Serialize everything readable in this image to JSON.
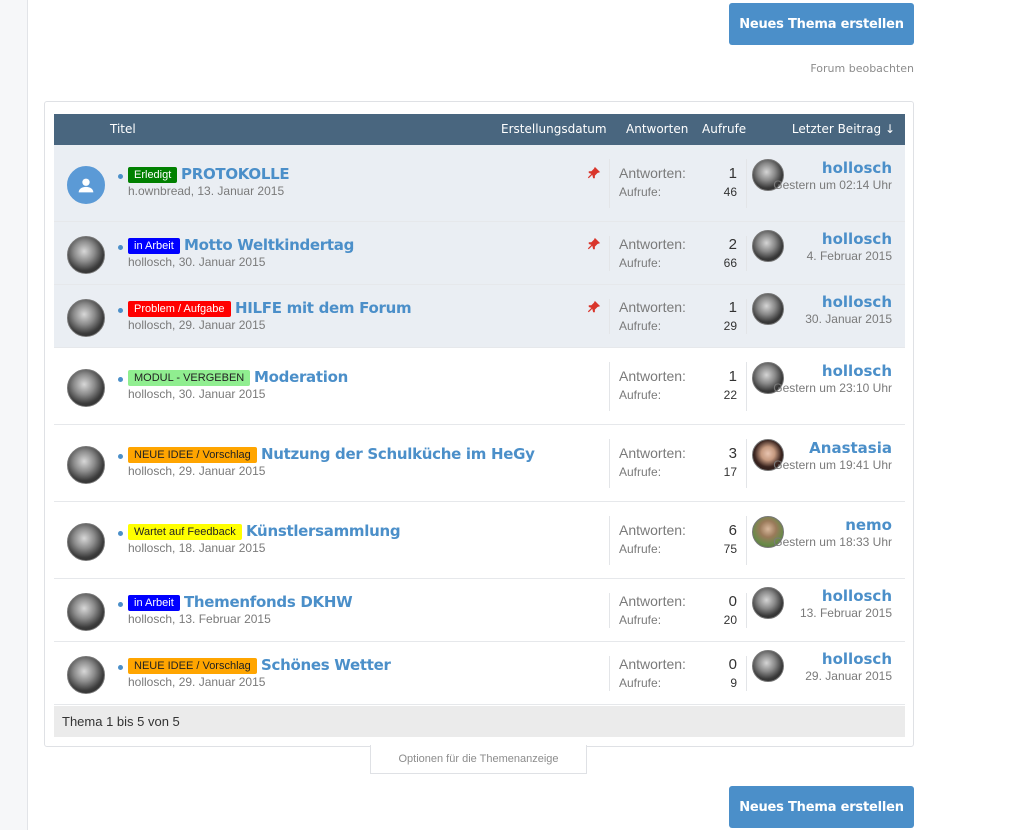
{
  "actions": {
    "new_thread": "Neues Thema erstellen",
    "watch_forum": "Forum beobachten",
    "thread_display_options": "Optionen für die Themenanzeige"
  },
  "table_header": {
    "title": "Titel",
    "created": "Erstellungsdatum",
    "replies": "Antworten",
    "views": "Aufrufe",
    "last_post": "Letzter Beitrag ↓"
  },
  "labels": {
    "replies": "Antworten:",
    "views": "Aufrufe:"
  },
  "threads": [
    {
      "prefix": "Erledigt",
      "prefix_bg": "#008000",
      "prefix_fg": "#ffffff",
      "title": "PROTOKOLLE",
      "meta": "h.ownbread, 13. Januar 2015",
      "sticky": true,
      "replies": "1",
      "views": "46",
      "last_user": "hollosch",
      "last_date": "Gestern um 02:14 Uhr",
      "avatar": "default"
    },
    {
      "prefix": "in Arbeit",
      "prefix_bg": "#0000ff",
      "prefix_fg": "#ffffff",
      "title": "Motto Weltkindertag",
      "meta": "hollosch, 30. Januar 2015",
      "sticky": true,
      "replies": "2",
      "views": "66",
      "last_user": "hollosch",
      "last_date": "4. Februar 2015",
      "avatar": "photo"
    },
    {
      "prefix": "Problem / Aufgabe",
      "prefix_bg": "#ff0000",
      "prefix_fg": "#ffffff",
      "title": "HILFE mit dem Forum",
      "meta": "hollosch, 29. Januar 2015",
      "sticky": true,
      "replies": "1",
      "views": "29",
      "last_user": "hollosch",
      "last_date": "30. Januar 2015",
      "avatar": "photo"
    },
    {
      "prefix": "MODUL - VERGEBEN",
      "prefix_bg": "#90ee90",
      "prefix_fg": "#222222",
      "title": "Moderation",
      "meta": "hollosch, 30. Januar 2015",
      "sticky": false,
      "replies": "1",
      "views": "22",
      "last_user": "hollosch",
      "last_date": "Gestern um 23:10 Uhr",
      "avatar": "photo"
    },
    {
      "prefix": "NEUE IDEE / Vorschlag",
      "prefix_bg": "#ffa500",
      "prefix_fg": "#222222",
      "title": "Nutzung der Schulküche im HeGy",
      "meta": "hollosch, 29. Januar 2015",
      "sticky": false,
      "replies": "3",
      "views": "17",
      "last_user": "Anastasia",
      "last_date": "Gestern um 19:41 Uhr",
      "avatar": "photo"
    },
    {
      "prefix": "Wartet auf Feedback",
      "prefix_bg": "#ffff00",
      "prefix_fg": "#222222",
      "title": "Künstlersammlung",
      "meta": "hollosch, 18. Januar 2015",
      "sticky": false,
      "replies": "6",
      "views": "75",
      "last_user": "nemo",
      "last_date": "Gestern um 18:33 Uhr",
      "avatar": "photo"
    },
    {
      "prefix": "in Arbeit",
      "prefix_bg": "#0000ff",
      "prefix_fg": "#ffffff",
      "title": "Themenfonds DKHW",
      "meta": "hollosch, 13. Februar 2015",
      "sticky": false,
      "replies": "0",
      "views": "20",
      "last_user": "hollosch",
      "last_date": "13. Februar 2015",
      "avatar": "photo"
    },
    {
      "prefix": "NEUE IDEE / Vorschlag",
      "prefix_bg": "#ffa500",
      "prefix_fg": "#222222",
      "title": "Schönes Wetter",
      "meta": "hollosch, 29. Januar 2015",
      "sticky": false,
      "replies": "0",
      "views": "9",
      "last_user": "hollosch",
      "last_date": "29. Januar 2015",
      "avatar": "photo"
    }
  ],
  "pagination": "Thema 1 bis 5 von 5"
}
